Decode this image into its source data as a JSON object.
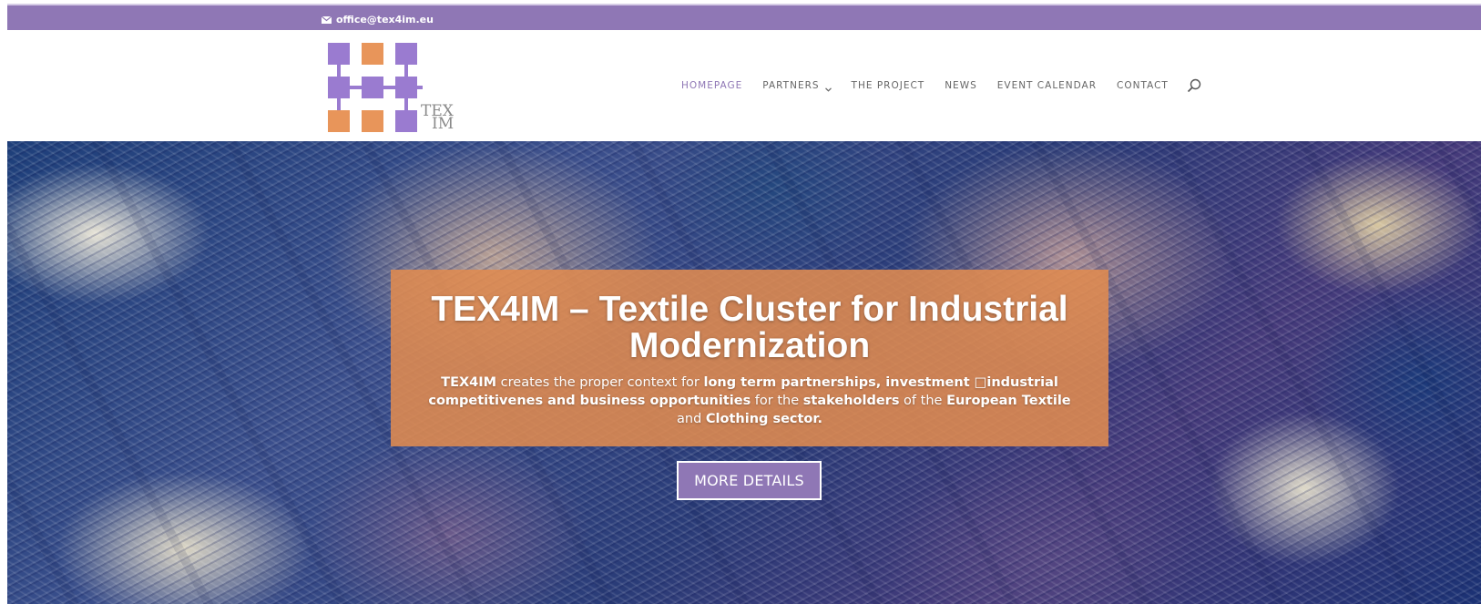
{
  "topbar": {
    "email": "office@tex4im.eu",
    "email_icon": "envelope-icon",
    "color": "#8f77b5"
  },
  "logo": {
    "text_line1": "TEX",
    "text_line2": "IM",
    "colors": {
      "purple": "#9a7bd0",
      "orange": "#e8955a"
    }
  },
  "nav": {
    "items": [
      {
        "label": "HOMEPAGE",
        "active": true
      },
      {
        "label": "PARTNERS",
        "dropdown": true
      },
      {
        "label": "THE PROJECT"
      },
      {
        "label": "NEWS"
      },
      {
        "label": "EVENT CALENDAR"
      },
      {
        "label": "CONTACT"
      }
    ],
    "search_icon": "search-icon",
    "active_color": "#8f77b5"
  },
  "hero": {
    "title": "TEX4IM – Textile Cluster for Industrial Modernization",
    "intro": {
      "s1": "TEX4IM",
      "s2": " creates the proper context for ",
      "s3": "long term partnerships, investment □industrial competitivenes and business opportunities",
      "s4": " for the ",
      "s5": "stakeholders",
      "s6": " of the ",
      "s7": "European Textile",
      "s8": " and ",
      "s9": "Clothing sector."
    },
    "caption_color": "#e08b50",
    "button_label": "MORE DETAILS"
  }
}
